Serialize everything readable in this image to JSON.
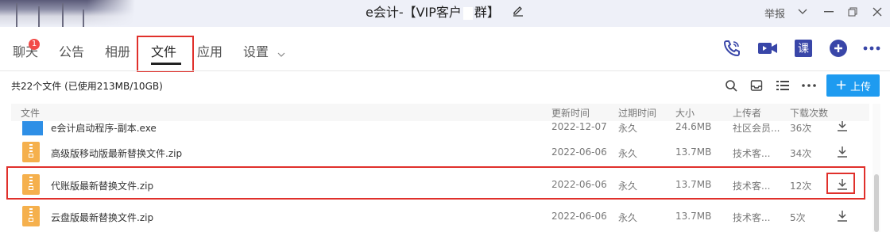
{
  "window": {
    "title": "e会计-【VIP客户",
    "title_suffix": "群】",
    "report": "举报"
  },
  "tabs": [
    {
      "label": "聊天",
      "badge": "1"
    },
    {
      "label": "公告"
    },
    {
      "label": "相册"
    },
    {
      "label": "文件",
      "active": true
    },
    {
      "label": "应用"
    },
    {
      "label": "设置"
    }
  ],
  "toolbar_icons": [
    "phone-icon",
    "video-icon",
    "course-icon",
    "add-circle-icon",
    "more-icon"
  ],
  "course_label": "课",
  "summary": "共22个文件 (已使用213MB/10GB)",
  "upload_label": "上传",
  "columns": {
    "file": "文件",
    "updated": "更新时间",
    "expire": "过期时间",
    "size": "大小",
    "uploader": "上传者",
    "downloads": "下载次数"
  },
  "files": [
    {
      "name": "e会计启动程序-副本.exe",
      "updated": "2022-12-07",
      "expire": "永久",
      "size": "24.6MB",
      "uploader": "社区会员...",
      "downloads": "36次",
      "type": "exe"
    },
    {
      "name": "高级版移动版最新替换文件.zip",
      "updated": "2022-06-06",
      "expire": "永久",
      "size": "13.7MB",
      "uploader": "技术客...",
      "downloads": "34次",
      "type": "zip"
    },
    {
      "name": "代账版最新替换文件.zip",
      "updated": "2022-06-06",
      "expire": "永久",
      "size": "13.7MB",
      "uploader": "技术客...",
      "downloads": "12次",
      "type": "zip"
    },
    {
      "name": "云盘版最新替换文件.zip",
      "updated": "2022-06-06",
      "expire": "永久",
      "size": "13.7MB",
      "uploader": "技术客...",
      "downloads": "5次",
      "type": "zip"
    }
  ],
  "colors": {
    "accent": "#1e9bf0",
    "icon_purple": "#3946a8",
    "highlight": "#e0302b",
    "zip": "#f5b04d"
  }
}
